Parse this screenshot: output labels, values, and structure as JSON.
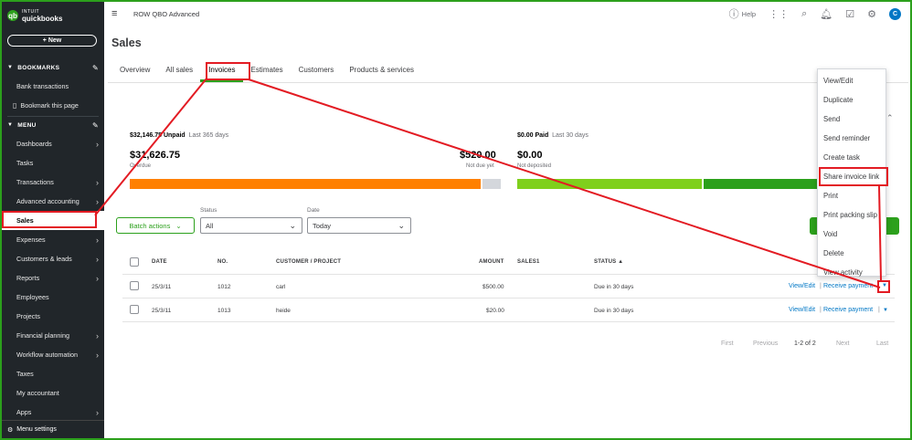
{
  "app": {
    "logo_line1": "INTUIT",
    "logo_line2": "quickbooks",
    "company": "ROW QBO Advanced",
    "help_label": "Help",
    "avatar_initial": "C"
  },
  "sidebar": {
    "new_button": "+ New",
    "bookmarks_header": "BOOKMARKS",
    "bookmarks": [
      "Bank transactions",
      "Bookmark this page"
    ],
    "menu_header": "MENU",
    "items": [
      {
        "label": "Dashboards",
        "chevron": true
      },
      {
        "label": "Tasks",
        "chevron": false
      },
      {
        "label": "Transactions",
        "chevron": true
      },
      {
        "label": "Advanced accounting",
        "chevron": true
      },
      {
        "label": "Sales",
        "chevron": false
      },
      {
        "label": "Expenses",
        "chevron": true
      },
      {
        "label": "Customers & leads",
        "chevron": true
      },
      {
        "label": "Reports",
        "chevron": true
      },
      {
        "label": "Employees",
        "chevron": false
      },
      {
        "label": "Projects",
        "chevron": false
      },
      {
        "label": "Financial planning",
        "chevron": true
      },
      {
        "label": "Workflow automation",
        "chevron": true
      },
      {
        "label": "Taxes",
        "chevron": false
      },
      {
        "label": "My accountant",
        "chevron": false
      },
      {
        "label": "Apps",
        "chevron": true
      }
    ],
    "menu_settings": "Menu settings",
    "active": "Sales"
  },
  "page": {
    "title": "Sales",
    "tabs": [
      "Overview",
      "All sales",
      "Invoices",
      "Estimates",
      "Customers",
      "Products & services"
    ],
    "active_tab": "Invoices"
  },
  "money_bar": {
    "unpaid_amount": "$32,146.75 Unpaid",
    "unpaid_period": "Last 365 days",
    "overdue_amount": "$31,626.75",
    "overdue_label": "Overdue",
    "not_due_amount": "$520.00",
    "not_due_label": "Not due yet",
    "paid_amount": "$0.00 Paid",
    "paid_period": "Last 30 days",
    "not_deposited_amount": "$0.00",
    "not_deposited_label": "Not deposited"
  },
  "filters": {
    "batch_actions": "Batch actions",
    "status_label": "Status",
    "status_value": "All",
    "date_label": "Date",
    "date_value": "Today"
  },
  "table": {
    "headers": [
      "DATE",
      "NO.",
      "CUSTOMER / PROJECT",
      "AMOUNT",
      "SALES1",
      "STATUS ▲"
    ],
    "rows": [
      {
        "date": "25/3/11",
        "no": "1012",
        "customer": "carl",
        "amount": "$500.00",
        "status": "Due in 30 days",
        "view": "View/Edit",
        "action": "Receive payment"
      },
      {
        "date": "25/3/11",
        "no": "1013",
        "customer": "heide",
        "amount": "$20.00",
        "status": "Due in 30 days",
        "view": "View/Edit",
        "action": "Receive payment"
      }
    ]
  },
  "pager": {
    "first": "First",
    "previous": "Previous",
    "range": "1-2 of 2",
    "next": "Next",
    "last": "Last"
  },
  "dropdown": {
    "items": [
      "View/Edit",
      "Duplicate",
      "Send",
      "Send reminder",
      "Create task",
      "Share invoice link",
      "Print",
      "Print packing slip",
      "Void",
      "Delete",
      "View activity"
    ],
    "highlighted": "Share invoice link"
  },
  "colors": {
    "brand_green": "#2ca01c",
    "sidebar_bg": "#21262a",
    "overdue_bar": "#ff8000",
    "not_due_bar": "#d4d7dc",
    "paid_bar_light": "#7fd01c",
    "paid_bar_dark": "#2ca01c",
    "annotation_red": "#e31b23",
    "link_blue": "#0077c5"
  }
}
